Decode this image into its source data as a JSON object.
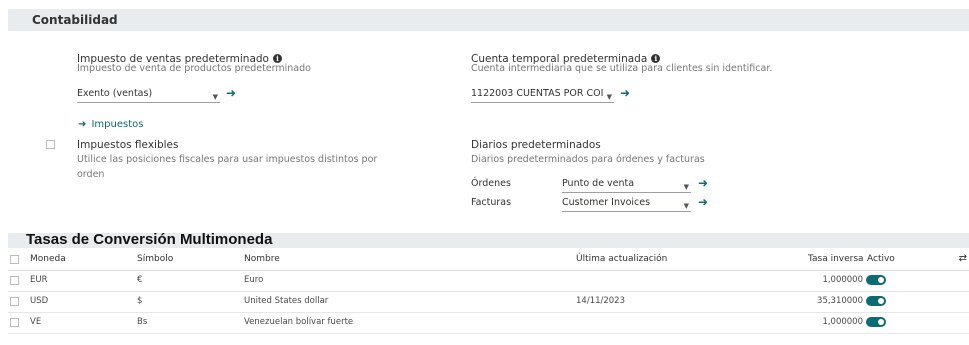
{
  "section": {
    "title": "Contabilidad"
  },
  "sales_tax": {
    "title": "Impuesto de ventas predeterminado",
    "description": "Impuesto de venta de productos predeterminado",
    "value": "Exento (ventas)",
    "link_label": "Impuestos"
  },
  "flex_taxes": {
    "title": "Impuestos flexibles",
    "description": "Utilice las posiciones fiscales para usar impuestos distintos por orden"
  },
  "suspense_account": {
    "title": "Cuenta temporal predeterminada",
    "description": "Cuenta intermediaria que se utiliza para clientes sin identificar.",
    "value": "1122003 CUENTAS POR COI"
  },
  "journals": {
    "title": "Diarios predeterminados",
    "description": "Diarios predeterminados para órdenes y facturas",
    "orders_label": "Órdenes",
    "orders_value": "Punto de venta",
    "invoices_label": "Facturas",
    "invoices_value": "Customer Invoices"
  },
  "rates": {
    "title": "Tasas de Conversión Multimoneda",
    "headers": {
      "currency": "Moneda",
      "symbol": "Símbolo",
      "name": "Nombre",
      "last_update": "Última actualización",
      "inverse_rate": "Tasa inversa",
      "active": "Activo"
    },
    "rows": [
      {
        "currency": "EUR",
        "symbol": "€",
        "name": "Euro",
        "last_update": "",
        "inverse_rate": "1,000000",
        "active": true
      },
      {
        "currency": "USD",
        "symbol": "$",
        "name": "United States dollar",
        "last_update": "14/11/2023",
        "inverse_rate": "35,310000",
        "active": true
      },
      {
        "currency": "VE",
        "symbol": "Bs",
        "name": "Venezuelan bolívar fuerte",
        "last_update": "",
        "inverse_rate": "1,000000",
        "active": true
      }
    ]
  },
  "colors": {
    "accent": "#0f6b73",
    "header_bg": "#e9ecef"
  },
  "icons": [
    "info-icon",
    "arrow-right-icon",
    "caret-down-icon",
    "checkbox-icon",
    "toggle-icon",
    "swap-icon"
  ]
}
